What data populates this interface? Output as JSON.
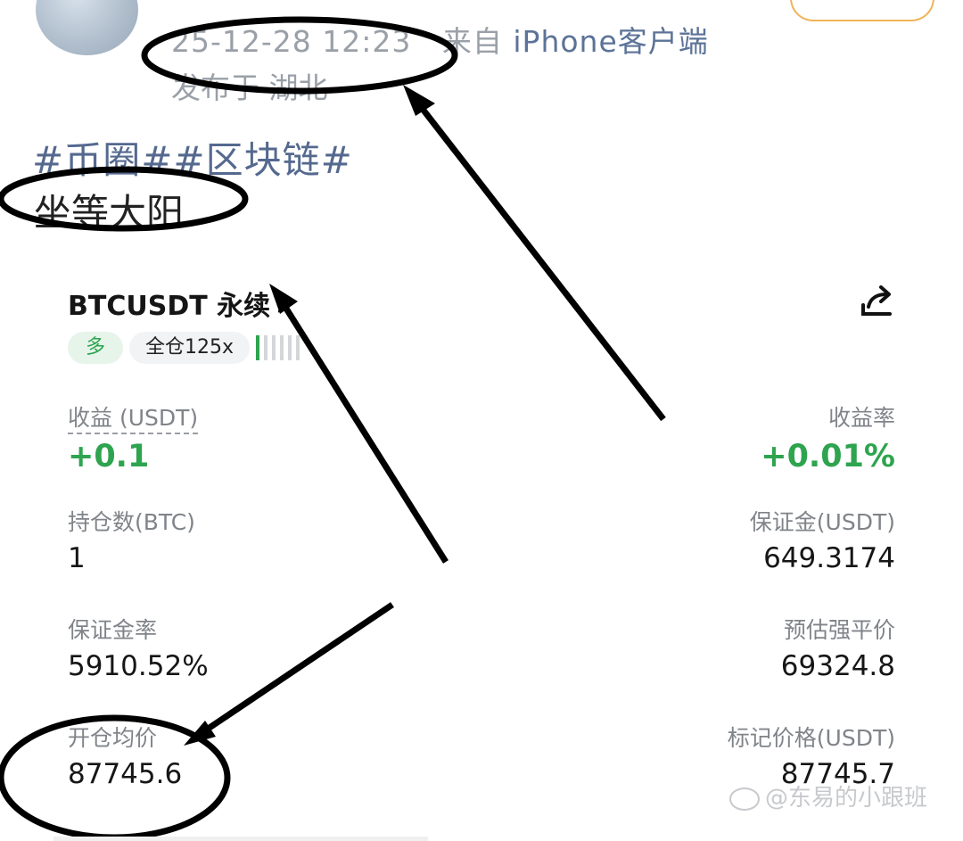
{
  "post": {
    "timestamp": "25-12-28 12:23",
    "source_prefix": "来自",
    "source_client": "iPhone客户端",
    "location": "发布于 湖北",
    "hashtags": "#币圈##区块链#",
    "text": "坐等大阳"
  },
  "position": {
    "symbol": "BTCUSDT 永续",
    "chevron": "›",
    "share_icon": "share-icon",
    "side_tag": "多",
    "leverage_tag": "全仓125x",
    "fields": {
      "pnl_label": "收益 (USDT)",
      "pnl_value": "+0.1",
      "roe_label": "收益率",
      "roe_value": "+0.01%",
      "size_label": "持仓数(BTC)",
      "size_value": "1",
      "margin_label": "保证金(USDT)",
      "margin_value": "649.3174",
      "margin_ratio_label": "保证金率",
      "margin_ratio_value": "5910.52%",
      "liq_label": "预估强平价",
      "liq_value": "69324.8",
      "entry_label": "开仓均价",
      "entry_value": "87745.6",
      "mark_label": "标记价格(USDT)",
      "mark_value": "87745.7"
    }
  },
  "colors": {
    "profit_green": "#2ea44f",
    "hashtag_blue": "#55698f",
    "follow_orange": "#f0b35a"
  },
  "watermark": "@东易的小跟班"
}
